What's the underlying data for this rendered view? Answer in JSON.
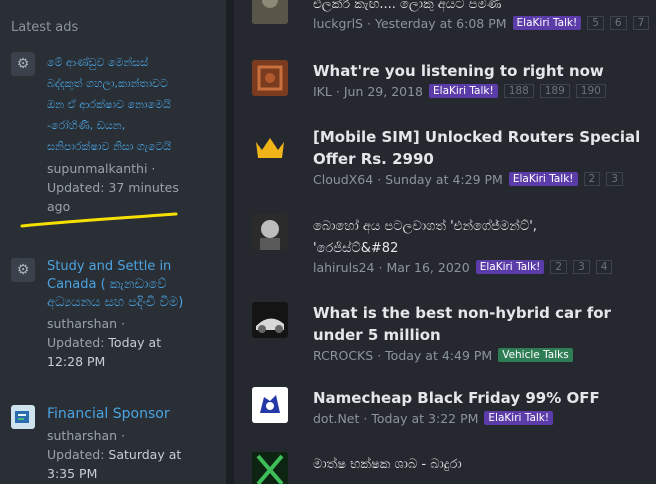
{
  "sidebar": {
    "title": "Latest ads",
    "ads": [
      {
        "icon": "gear-icon",
        "title": "මේ ආණ්ඩුව මෙන්සස් බද්දකුත් ගහලා,කාන්තාවට ඔන ඒ ආරක්ෂාව නොමෙයි -රෝහිණී, ඩයන, සනිපාරක්ෂාව නිසා ගැටෙයි",
        "user": "supunmalkanthi",
        "updated_label": "Updated: 37 minutes ago"
      },
      {
        "icon": "gear-icon",
        "title": "Study and Settle in Canada ( කැනඩාවේ අධ්‍යයනය සහ පදිංචි වීම)",
        "user": "sutharshan",
        "updated_label": "Updated:",
        "updated_value": "Today at 12:28 PM"
      },
      {
        "icon": "brand-logo-icon",
        "title": "Financial Sponsor",
        "user": "sutharshan",
        "updated_label": "Updated:",
        "updated_value": "Saturday at 3:35 PM"
      }
    ]
  },
  "threads": [
    {
      "title": "එලක්රි කැඟ.... ලොකු අයට පමණ",
      "author": "luckgrlS",
      "date": "Yesterday at 6:08 PM",
      "tag": "ElaKiri Talk!",
      "pages": [
        "5",
        "6",
        "7"
      ]
    },
    {
      "title": "What're you listening to right now",
      "author": "IKL",
      "date": "Jun 29, 2018",
      "tag": "ElaKiri Talk!",
      "pages": [
        "188",
        "189",
        "190"
      ]
    },
    {
      "title": "[Mobile SIM] Unlocked Routers Special Offer Rs. 2990",
      "author": "CloudX64",
      "date": "Sunday at 4:29 PM",
      "tag": "ElaKiri Talk!",
      "pages": [
        "2",
        "3"
      ]
    },
    {
      "title": "බොහෝ අය පටලවාගත් 'එන්ගේජ්මන්ට්', 'රෙජිස්ට්&#82",
      "author": "lahiruls24",
      "date": "Mar 16, 2020",
      "tag": "ElaKiri Talk!",
      "pages": [
        "2",
        "3",
        "4"
      ]
    },
    {
      "title": "What is the best non-hybrid car for under 5 million",
      "author": "RCROCKS",
      "date": "Today at 4:49 PM",
      "tag": "Vehicle Talks",
      "pages": []
    },
    {
      "title": "Namecheap Black Friday 99% OFF",
      "author": "dot.Net",
      "date": "Today at 3:22 PM",
      "tag": "ElaKiri Talk!",
      "pages": []
    },
    {
      "title": "මාත්ෂ භක්ෂක ශාබ - බාදුරා",
      "author": "",
      "date": "",
      "tag": "",
      "pages": []
    }
  ],
  "colors": {
    "sidebar_bg": "#2a2f36",
    "content_bg": "#25292f",
    "link": "#4aa3e0",
    "tag_purple": "#5c3ca8",
    "tag_green": "#2f7d55",
    "highlight_underline": "#f5e000"
  }
}
